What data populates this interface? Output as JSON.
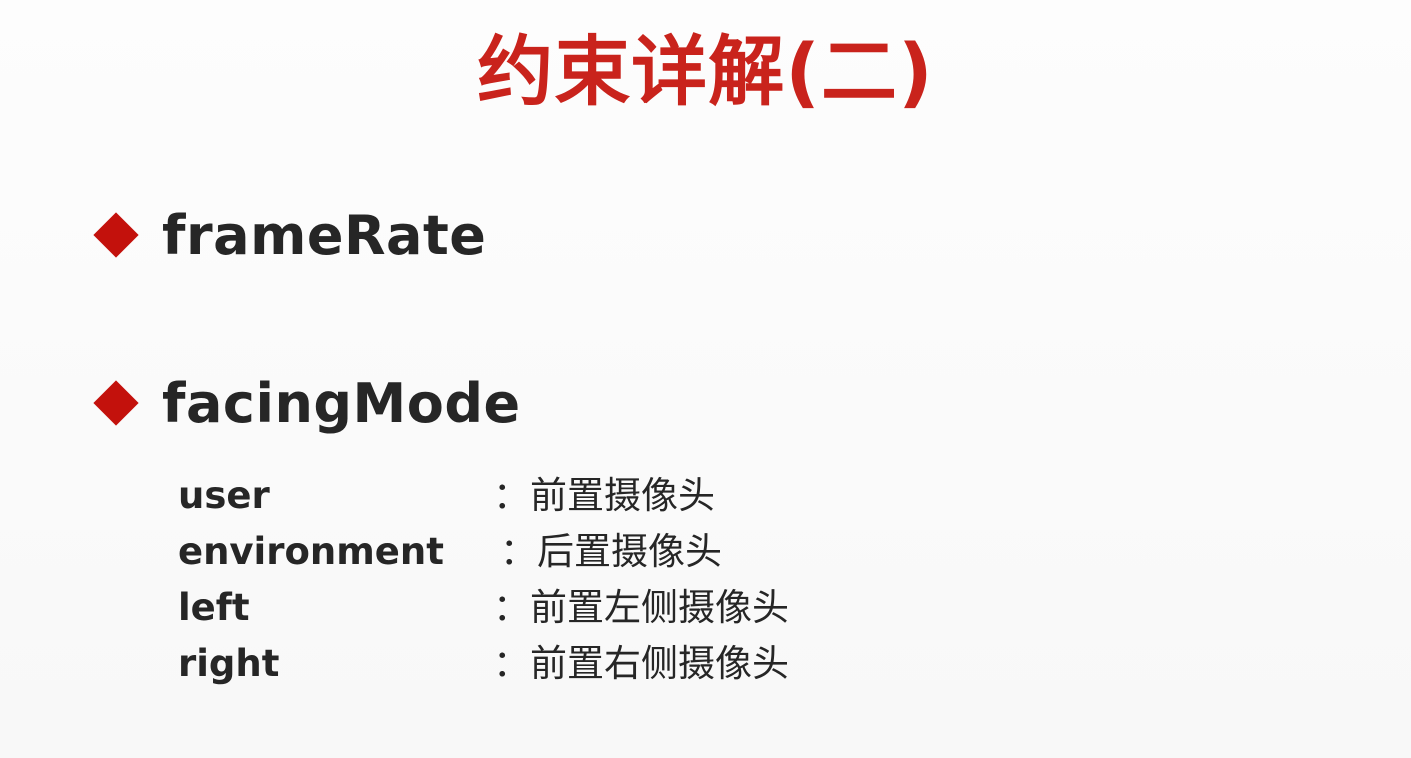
{
  "title": "约束详解(二)",
  "bullets": [
    {
      "label": "frameRate"
    },
    {
      "label": "facingMode"
    }
  ],
  "facing_mode_options": [
    {
      "key": "user",
      "value": "：前置摄像头"
    },
    {
      "key": "environment",
      "value": "：后置摄像头"
    },
    {
      "key": "left",
      "value": "：前置左侧摄像头"
    },
    {
      "key": "right",
      "value": "：前置右侧摄像头"
    }
  ],
  "colors": {
    "title": "#c9231c",
    "bullet_marker": "#c3110c",
    "text": "#262626",
    "background": "#ffffff"
  },
  "icons": {
    "bullet_marker": "diamond-icon"
  }
}
